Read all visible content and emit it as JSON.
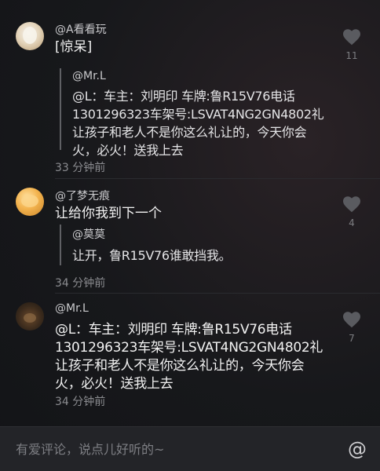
{
  "colors": {
    "background": "#17181b",
    "text_primary": "#f2f2f2",
    "text_secondary": "#8b8c90",
    "like_icon": "#5a5b60",
    "input_bar": "#232428"
  },
  "comments": [
    {
      "username": "@A看看玩",
      "text": "[惊呆]",
      "quote": {
        "username": "@Mr.L",
        "text": "@L：车主：刘明印 车牌:鲁R15V76电话1301296323车架号:LSVAT4NG2GN4802礼让孩子和老人不是你这么礼让的，今天你会火，必火！送我上去"
      },
      "time": "33 分钟前",
      "likes": "11",
      "like_icon": "heart-icon"
    },
    {
      "username": "@了梦无痕",
      "text": "让给你我到下一个",
      "quote": {
        "username": "@莫莫",
        "text": "让开，鲁R15V76谁敢挡我。"
      },
      "time": "34 分钟前",
      "likes": "4",
      "like_icon": "heart-icon"
    },
    {
      "username": "@Mr.L",
      "text": "@L：车主：刘明印 车牌:鲁R15V76电话1301296323车架号:LSVAT4NG2GN4802礼让孩子和老人不是你这么礼让的，今天你会火，必火！送我上去",
      "time": "34 分钟前",
      "likes": "7",
      "like_icon": "heart-icon"
    }
  ],
  "input": {
    "placeholder": "有爱评论，说点儿好听的~",
    "value": ""
  },
  "at_button": {
    "label": "@",
    "icon": "at-icon"
  }
}
